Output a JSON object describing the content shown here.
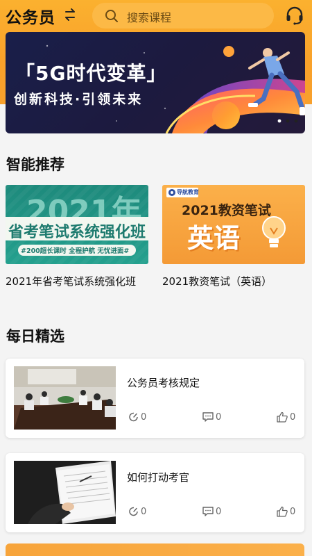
{
  "header": {
    "city": "公务员",
    "search_placeholder": "搜索课程"
  },
  "banner": {
    "headline": "「5G时代变革」",
    "subline": "创新科技·引领未来"
  },
  "recommend": {
    "title": "智能推荐",
    "items": [
      {
        "poster_year": "2021年",
        "poster_main": "省考笔试系统强化班",
        "poster_tag": "#200超长课时  全程护航  无忧进面#",
        "caption": "2021年省考笔试系统强化班"
      },
      {
        "poster_logo": "导航教育",
        "poster_main": "2021教资笔试",
        "poster_big": "英语",
        "caption": "2021教资笔试（英语）"
      }
    ]
  },
  "daily": {
    "title": "每日精选",
    "items": [
      {
        "title": "公务员考核规定",
        "views": "0",
        "comments": "0",
        "likes": "0"
      },
      {
        "title": "如何打动考官",
        "views": "0",
        "comments": "0",
        "likes": "0"
      }
    ]
  },
  "colors": {
    "brand": "#f9a12a",
    "search_bg": "#fcb946",
    "teal": "#24a08e"
  }
}
